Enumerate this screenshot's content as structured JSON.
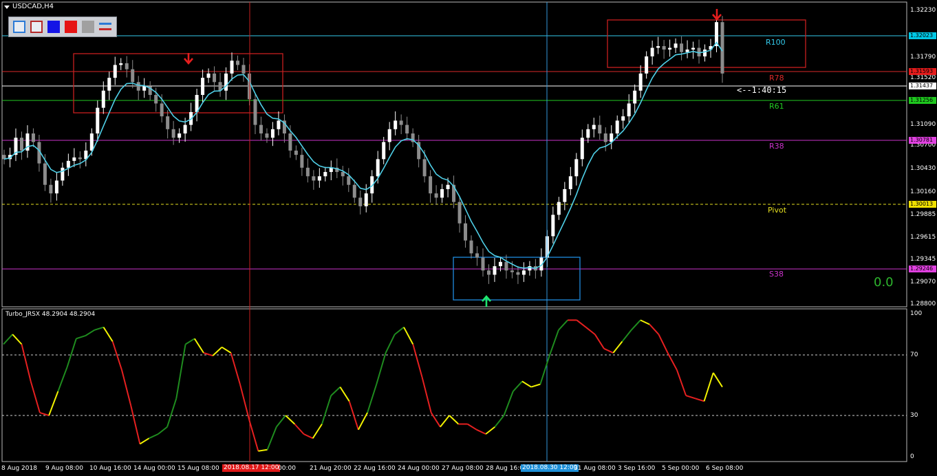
{
  "chart": {
    "symbol": "USDCAD,H4",
    "indicator_title": "Turbo_JRSX 48.2904 48.2904",
    "countdown": "<--1:40:15",
    "corner_value": "0.0",
    "price_scale": [
      "1.32230",
      "1.31790",
      "1.31520",
      "1.31090",
      "1.30700",
      "1.30430",
      "1.30160",
      "1.29885",
      "1.29615",
      "1.29345",
      "1.29070",
      "1.28800"
    ],
    "price_tags": [
      {
        "text": "1.32023",
        "bg": "#00c8e6"
      },
      {
        "text": "1.31593",
        "bg": "#e41b1b"
      },
      {
        "text": "1.31437",
        "bg": "#ffffff"
      },
      {
        "text": "1.31256",
        "bg": "#1ec81e"
      },
      {
        "text": "1.30781",
        "bg": "#e040e0"
      },
      {
        "text": "1.30013",
        "bg": "#f0e000"
      },
      {
        "text": "1.29246",
        "bg": "#e040e0"
      }
    ],
    "levels": [
      {
        "name": "R100",
        "color": "#33ccee",
        "price": 1.32023
      },
      {
        "name": "R78",
        "color": "#dd2a2a",
        "price": 1.31593
      },
      {
        "name": "R61",
        "color": "#22cc22",
        "price": 1.31256
      },
      {
        "name": "R38",
        "color": "#cc33cc",
        "price": 1.30781
      },
      {
        "name": "Pivot",
        "color": "#e6e020",
        "price": 1.30013
      },
      {
        "name": "S38",
        "color": "#cc33cc",
        "price": 1.29246
      }
    ],
    "indicator_scale": [
      "100",
      "70",
      "30",
      "0"
    ],
    "time_labels": [
      "8 Aug 2018",
      "9 Aug 08:00",
      "10 Aug 16:00",
      "14 Aug 00:00",
      "15 Aug 08:00",
      "2018.08.17 12:00",
      "00:00",
      "21 Aug 20:00",
      "22 Aug 16:00",
      "24 Aug 00:00",
      "27 Aug 08:00",
      "28 Aug 16:00",
      "2018.08.30 12:00",
      "31 Aug 08:00",
      "3 Sep 16:00",
      "5 Sep 00:00",
      "6 Sep 08:00"
    ],
    "toolbar_icons": [
      "outline-blue-icon",
      "outline-red-icon",
      "fill-blue-icon",
      "fill-red-icon",
      "fill-gray-icon",
      "lines-icon"
    ],
    "colors": {
      "background": "#000000",
      "bull_candle": "#ffffff",
      "bear_candle": "#8c8c8c",
      "moving_average": "#4fd0e8",
      "crosshair_red": "#c82020",
      "crosshair_blue": "#3399dd",
      "osc_up": "#1f8c1f",
      "osc_down": "#e62020",
      "osc_turn": "#f2f200"
    }
  }
}
